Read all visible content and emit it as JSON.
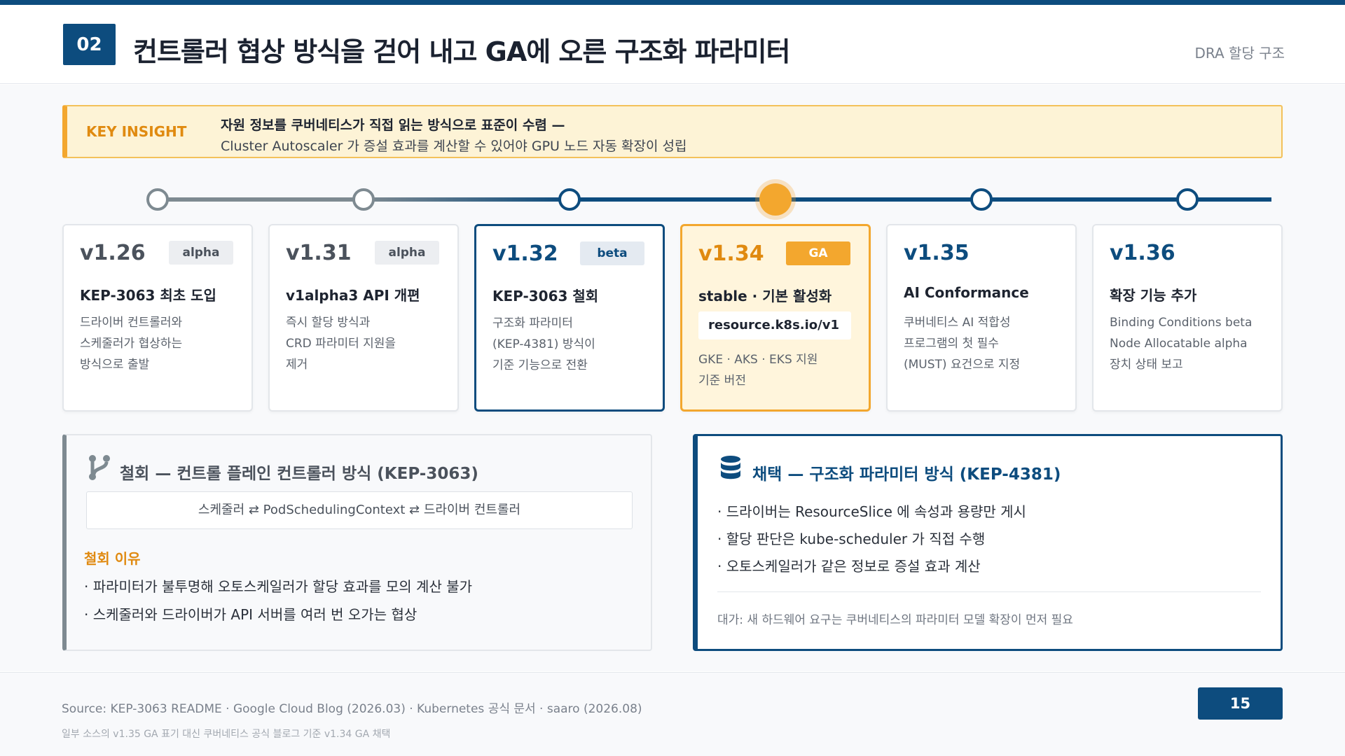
{
  "header": {
    "number": "02",
    "title": "컨트롤러 협상 방식을 걷어 내고 GA에 오른 구조화 파라미터",
    "section_tag": "DRA 할당 구조"
  },
  "insight": {
    "label": "KEY INSIGHT",
    "title": "자원 정보를 쿠버네티스가 직접 읽는 방식으로 표준이 수렴 —",
    "body": "Cluster Autoscaler 가 증설 효과를 계산할 수 있어야 GPU 노드 자동 확장이 성립"
  },
  "cards": [
    {
      "version": "v1.26",
      "tag": "alpha",
      "title": "KEP-3063 최초 도입",
      "lines": [
        "드라이버 컨트롤러와",
        "스케줄러가 협상하는",
        "방식으로 출발"
      ]
    },
    {
      "version": "v1.31",
      "tag": "alpha",
      "title": "v1alpha3 API 개편",
      "lines": [
        "즉시 할당 방식과",
        "CRD 파라미터 지원을",
        "제거"
      ]
    },
    {
      "version": "v1.32",
      "tag": "beta",
      "title": "KEP-3063 철회",
      "lines": [
        "구조화 파라미터",
        "(KEP-4381) 방식이",
        "기준 기능으로 전환"
      ]
    },
    {
      "version": "v1.34",
      "tag": "GA",
      "title": "stable · 기본 활성화",
      "code": "resource.k8s.io/v1",
      "lines": [
        "GKE · AKS · EKS 지원",
        "기준 버전"
      ]
    },
    {
      "version": "v1.35",
      "title": "AI Conformance",
      "lines": [
        "쿠버네티스 AI 적합성",
        "프로그램의 첫 필수",
        "(MUST) 요건으로 지정"
      ]
    },
    {
      "version": "v1.36",
      "title": "확장 기능 추가",
      "lines": [
        "Binding Conditions beta",
        "Node Allocatable alpha",
        "장치 상태 보고"
      ]
    }
  ],
  "left_panel": {
    "icon": "branch-icon",
    "title": "철회 — 컨트롤 플레인 컨트롤러 방식 (KEP-3063)",
    "flow": "스케줄러 ⇄ PodSchedulingContext ⇄ 드라이버 컨트롤러",
    "reason_label": "철회 이유",
    "bullets": [
      "· 파라미터가 불투명해 오토스케일러가 할당 효과를 모의 계산 불가",
      "· 스케줄러와 드라이버가 API 서버를 여러 번 오가는 협상"
    ]
  },
  "right_panel": {
    "icon": "database-icon",
    "title": "채택 — 구조화 파라미터 방식 (KEP-4381)",
    "bullets": [
      "· 드라이버는 ResourceSlice 에 속성과 용량만 게시",
      "· 할당 판단은 kube-scheduler 가 직접 수행",
      "· 오토스케일러가 같은 정보로 증설 효과 계산"
    ],
    "note": "대가: 새 하드웨어 요구는 쿠버네티스의 파라미터 모델 확장이 먼저 필요"
  },
  "footer": {
    "source": "Source: KEP-3063 README · Google Cloud Blog (2026.03) · Kubernetes 공식 문서 · saaro (2026.08)",
    "footnote": "일부 소스의 v1.35 GA 표기 대신 쿠버네티스 공식 블로그 기준 v1.34 GA 채택",
    "page": "15"
  },
  "colors": {
    "primary": "#0d4c7e",
    "accent": "#f3a72e",
    "muted": "#7e8a91"
  }
}
